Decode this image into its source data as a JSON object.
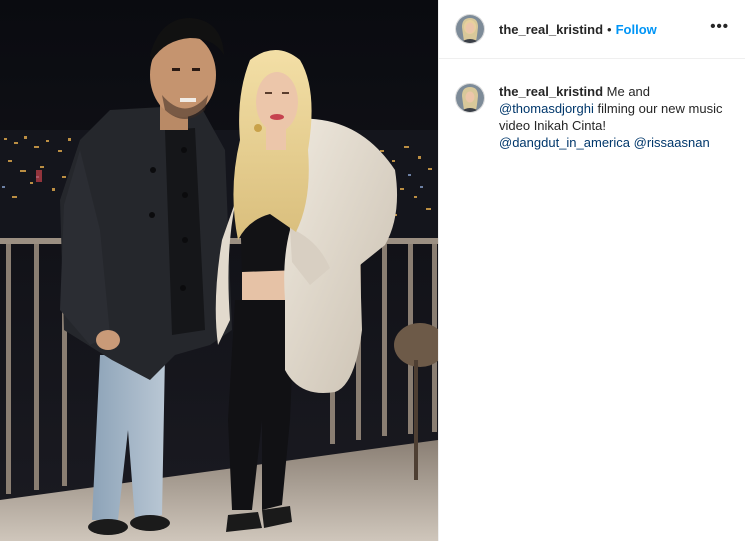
{
  "post": {
    "username": "the_real_kristind",
    "follow_label": "Follow",
    "separator": "•",
    "more_icon": "more-options-icon",
    "more_label": "•••"
  },
  "caption": {
    "username": "the_real_kristind",
    "text_1": " Me and ",
    "mention_1": "@thomasdjorghi",
    "text_2": " filming our new music video Inikah Cinta! ",
    "mention_2": "@dangdut_in_america",
    "text_3": " ",
    "mention_3": "@rissaasnan"
  },
  "colors": {
    "link": "#0095f6",
    "mention": "#00376b",
    "text": "#262626"
  }
}
